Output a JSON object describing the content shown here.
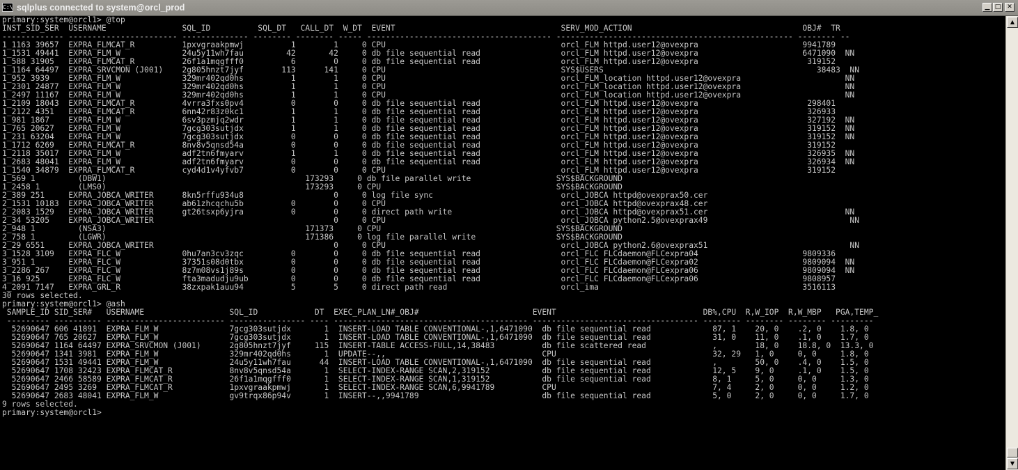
{
  "window": {
    "title": "sqlplus connected to system@orcl_prod",
    "app_icon": "C:\\",
    "minimize_glyph": "▁",
    "maximize_glyph": "□",
    "close_glyph": "✕"
  },
  "scrollbar": {
    "up_glyph": "▲",
    "down_glyph": "▼",
    "position_fraction": 1.0
  },
  "colors": {
    "console_background": "#000000",
    "console_text": "#c7c7c7",
    "titlebar": "#9c9a94"
  },
  "console": {
    "lines": [
      "primary:system@orcl1> @top",
      "",
      "INST_SID_SER  USERNAME                SQL_ID          SQL_DT   CALL_DT  W_DT  EVENT                                   SERV_MOD_ACTION                                    OBJ#  TR",
      "------------- ----------------------- -------------- -------- -------- ----- --------------------------------------- -------------------------------------------------- -------- --",
      "1_1163 39657  EXPRA_FLMCAT_R          1pxvgraakpmwj          1        1     0 CPU                                     orcl_FLM httpd.user12@ovexpra                      9941789",
      "1_1531 49441  EXPRA_FLM_W             24u5y11wh7fau         42       42     0 db file sequential read                 orcl_FLM httpd.user12@ovexpra                      6471090  NN",
      "1_588 31905   EXPRA_FLMCAT_R          26f1a1mqgfff0          6        0     0 db file sequential read                 orcl_FLM httpd.user12@ovexpra                       319152",
      "1_1164 64497  EXPRA_SRVCMON (J001)    2g805hnzt7jyf        113      141     0 CPU                                     SYS$USERS                                             38483  NN",
      "1_952 3939    EXPRA_FLM_W             329mr402qd0hs          1        1     0 CPU                                     orcl_FLM_location httpd.user12@ovexpra                      NN",
      "1_2301 24877  EXPRA_FLM_W             329mr402qd0hs          1        1     0 CPU                                     orcl_FLM_location httpd.user12@ovexpra                      NN",
      "1_2497 11167  EXPRA_FLM_W             329mr402qd0hs          1        1     0 CPU                                     orcl_FLM_location httpd.user12@ovexpra                      NN",
      "1_2109 18043  EXPRA_FLMCAT_R          4vrra3fxs0pv4          0        0     0 db file sequential read                 orcl_FLM httpd.user12@ovexpra                       298401",
      "1_2122 4351   EXPRA_FLMCAT_R          6nn42r83z0kc1          1        1     0 db file sequential read                 orcl_FLM httpd.user12@ovexpra                       326933",
      "1_981 1867    EXPRA_FLM_W             6sv3pzmjq2wdr          1        1     0 db file sequential read                 orcl_FLM httpd.user12@ovexpra                       327192  NN",
      "1_765 20627   EXPRA_FLM_W             7gcg303sutjdx          1        1     0 db file sequential read                 orcl_FLM httpd.user12@ovexpra                       319152  NN",
      "1_231 63204   EXPRA_FLM_W             7gcg303sutjdx          0        0     0 db file sequential read                 orcl_FLM httpd.user12@ovexpra                       319152  NN",
      "1_1712 6269   EXPRA_FLMCAT_R          8nv8v5qnsd54a          0        0     0 db file sequential read                 orcl_FLM httpd.user12@ovexpra                       319152",
      "1_2118 35017  EXPRA_FLM_W             adf2tn6fmyarv          1        1     0 db file sequential read                 orcl_FLM httpd.user12@ovexpra                       326935  NN",
      "1_2683 48041  EXPRA_FLM_W             adf2tn6fmyarv          0        0     0 db file sequential read                 orcl_FLM httpd.user12@ovexpra                       326934  NN",
      "1_1540 34879  EXPRA_FLMCAT_R          cyd4d1v4yfvb7          0        0     0 CPU                                     orcl_FLM httpd.user12@ovexpra                       319152",
      "1_569 1         (DBW1)                                          173293     0 db file parallel write                  SYS$BACKGROUND",
      "1_2458 1        (LMS0)                                          173293     0 CPU                                     SYS$BACKGROUND",
      "2_389 251     EXPRA_JOBCA_WRITER      8kn5rffu934u8                   0     0 log file sync                           orcl_JOBCA httpd@ovexprax50.cer",
      "2_1531 10183  EXPRA_JOBCA_WRITER      ab61zhcqchu5b          0        0     0 CPU                                     orcl_JOBCA httpd@ovexprax48.cer",
      "2_2083 1529   EXPRA_JOBCA_WRITER      gt26tsxp6yjra          0        0     0 direct path write                       orcl_JOBCA httpd@ovexprax51.cer                             NN",
      "2_34 53205    EXPRA_JOBCA_WRITER                                      0     0 CPU                                     orcl_JOBCA python2.5@ovexprax49                              NN",
      "2_948 1         (NSA3)                                          171373     0 CPU                                     SYS$BACKGROUND",
      "2_758 1         (LGWR)                                          171386     0 log file parallel write                 SYS$BACKGROUND",
      "2_29 6551     EXPRA_JOBCA_WRITER                                      0     0 CPU                                     orcl_JOBCA python2.6@ovexprax51                              NN",
      "3_1528 3109   EXPRA_FLC_W             0hu7an3cv3zqc          0        0     0 db file sequential read                 orcl_FLC FLCdaemon@FLCexpra04                      9809336",
      "3_951 1       EXPRA_FLC_W             37351s08d0tbx          0        0     0 db file sequential read                 orcl_FLC FLCdaemon@FLCexpra02                      9809094  NN",
      "3_2286 267    EXPRA_FLC_W             8z7m08vs1j89s          0        0     0 db file sequential read                 orcl_FLC FLCdaemon@FLCexpra06                      9809094  NN",
      "3_16 925      EXPRA_FLC_W             fta3madudju9ub         0        0     0 db file sequential read                 orcl_FLC FLCdaemon@FLCexpra06                      9808957",
      "4_2091 7147   EXPRA_GRL_R             38zxpak1auu94          5        5     0 direct path read                        orcl_ima                                           3516113",
      "",
      "30 rows selected.",
      "",
      "primary:system@orcl1> @ash",
      "",
      " SAMPLE_ID SID_SER#   USERNAME                  SQL_ID            DT  EXEC_PLAN_LN#_OBJ#                        EVENT                               DB%,CPU  R,W_IOP  R,W_MBP   PGA,TEMP_",
      " --------- ---------- ------------------------- ---------------- ---- ----------------------------------------- ----------------------------------- -------- -------- -------- ---------",
      "  52690647 606 41891  EXPRA_FLM_W               7gcg303sutjdx       1  INSERT-LOAD TABLE CONVENTIONAL-,1,6471090  db file sequential read             87, 1    20, 0    .2, 0    1.8, 0",
      "  52690647 765 20627  EXPRA_FLM_W               7gcg303sutjdx       1  INSERT-LOAD TABLE CONVENTIONAL-,1,6471090  db file sequential read             31, 0    11, 0    .1, 0    1.7, 0",
      "  52690647 1164 64497 EXPRA_SRVCMON (J001)      2g805hnzt7jyf     115  INSERT-TABLE ACCESS-FULL,14,38483          db file scattered read              ,        18, 0    18.8, 0  13.3, 0",
      "  52690647 1341 3981  EXPRA_FLM_W               329mr402qd0hs       1  UPDATE--,,                                 CPU                                 32, 29   1, 0     0, 0     1.8, 0",
      "  52690647 1531 49441 EXPRA_FLM_W               24u5y11wh7fau      44  INSERT-LOAD TABLE CONVENTIONAL-,1,6471090  db file sequential read             ,        50, 0    .4, 0    1.5, 0",
      "  52690647 1708 32423 EXPRA_FLMCAT_R            8nv8v5qnsd54a       1  SELECT-INDEX-RANGE SCAN,2,319152           db file sequential read             12, 5    9, 0     .1, 0    1.5, 0",
      "  52690647 2466 58589 EXPRA_FLMCAT_R            26f1a1mqgfff0       1  SELECT-INDEX-RANGE SCAN,1,319152           db file sequential read             8, 1     5, 0     0, 0     1.3, 0",
      "  52690647 2495 3269  EXPRA_FLMCAT_R            1pxvgraakpmwj       1  SELECT-INDEX-RANGE SCAN,6,9941789          CPU                                 7, 4     2, 0     0, 0     1.2, 0",
      "  52690647 2683 48041 EXPRA_FLM_W               gv9trqx86p94v       1  INSERT--,,9941789                          db file sequential read             5, 0     2, 0     0, 0     1.7, 0",
      "",
      "9 rows selected.",
      "",
      "primary:system@orcl1>"
    ]
  }
}
